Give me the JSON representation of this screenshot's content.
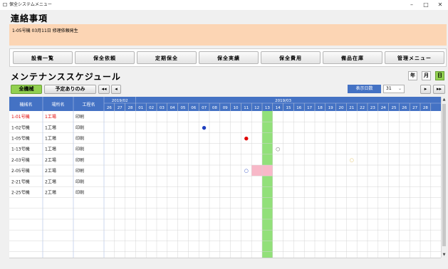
{
  "window": {
    "title": "保全システムメニュー",
    "minimize": "–",
    "maximize": "□",
    "close": "✕"
  },
  "notice": {
    "title": "連絡事項",
    "text": "1-05号機 03月11日 修理依頼発生"
  },
  "menu": {
    "items": [
      "設備一覧",
      "保全依頼",
      "定期保全",
      "保全実績",
      "保全費用",
      "備品在庫",
      "管理メニュー"
    ]
  },
  "schedule": {
    "title": "メンテナンススケジュール",
    "filter_all": "全機械",
    "filter_planned": "予定ありのみ",
    "nav_prev_far": "◂◂",
    "nav_prev": "◂",
    "nav_next": "▸",
    "nav_next_far": "▸▸",
    "view_year": "年",
    "view_month": "月",
    "view_day": "日",
    "days_label": "表示日数",
    "days_value": "31",
    "columns": [
      "機械名",
      "場所名",
      "工程名"
    ],
    "months": [
      "2019/02",
      "2019/03"
    ],
    "days": [
      "26",
      "27",
      "28",
      "01",
      "02",
      "03",
      "04",
      "05",
      "06",
      "07",
      "08",
      "09",
      "10",
      "11",
      "12",
      "13",
      "14",
      "15",
      "16",
      "17",
      "18",
      "19",
      "20",
      "21",
      "22",
      "23",
      "24",
      "25",
      "26",
      "27",
      "28"
    ],
    "today_index": 15,
    "rows": [
      {
        "machine": "1-01号機",
        "place": "1工場",
        "process": "印刷",
        "highlight": true
      },
      {
        "machine": "1-02号機",
        "place": "1工場",
        "process": "印刷"
      },
      {
        "machine": "1-05号機",
        "place": "1工場",
        "process": "印刷"
      },
      {
        "machine": "1-13号機",
        "place": "1工場",
        "process": "印刷"
      },
      {
        "machine": "2-03号機",
        "place": "2工場",
        "process": "印刷"
      },
      {
        "machine": "2-05号機",
        "place": "2工場",
        "process": "印刷"
      },
      {
        "machine": "2-21号機",
        "place": "2工場",
        "process": "印刷"
      },
      {
        "machine": "2-25号機",
        "place": "2工場",
        "process": "印刷"
      }
    ],
    "markers": [
      {
        "row": 1,
        "day": 9,
        "symbol": "●",
        "color": "#1f3fbf"
      },
      {
        "row": 2,
        "day": 13,
        "symbol": "●",
        "color": "#e00000"
      },
      {
        "row": 3,
        "day": 16,
        "symbol": "○",
        "color": "#555555"
      },
      {
        "row": 4,
        "day": 23,
        "symbol": "○",
        "color": "#e0c060"
      },
      {
        "row": 5,
        "day": 13,
        "symbol": "○",
        "color": "#3050c0"
      }
    ],
    "ranges": [
      {
        "row": 5,
        "start": 14,
        "end": 15,
        "color": "#f8b8c8"
      }
    ],
    "colors": {
      "header_bg": "#4472c4",
      "today_column": "#92e07a",
      "highlight_text": "#e00000"
    }
  }
}
